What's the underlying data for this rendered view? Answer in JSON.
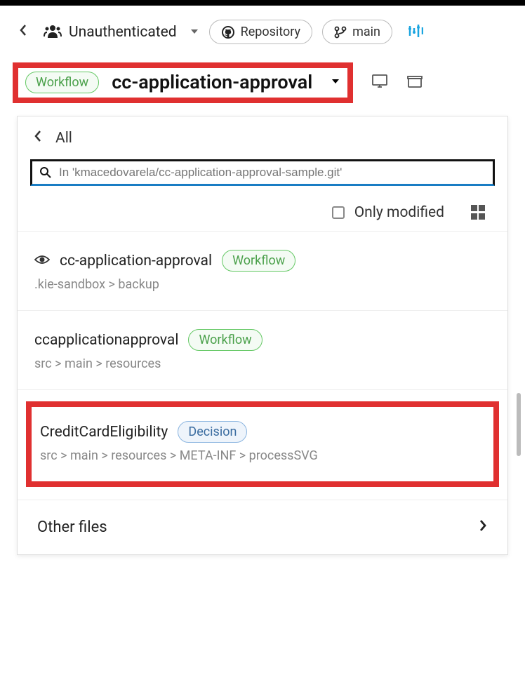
{
  "toolbar": {
    "auth_label": "Unauthenticated",
    "repo_label": "Repository",
    "branch_label": "main"
  },
  "title": {
    "badge": "Workflow",
    "text": "cc-application-approval"
  },
  "panel": {
    "back_all": "All",
    "search_placeholder": "In 'kmacedovarela/cc-application-approval-sample.git'",
    "only_modified": "Only modified"
  },
  "items": [
    {
      "title": "cc-application-approval",
      "badge": "Workflow",
      "path": ".kie-sandbox > backup",
      "has_eye": true
    },
    {
      "title": "ccapplicationapproval",
      "badge": "Workflow",
      "path": "src > main > resources",
      "has_eye": false
    },
    {
      "title": "CreditCardEligibility",
      "badge": "Decision",
      "path": "src > main > resources > META-INF > processSVG",
      "has_eye": false,
      "highlighted": true
    }
  ],
  "other_files": "Other files"
}
